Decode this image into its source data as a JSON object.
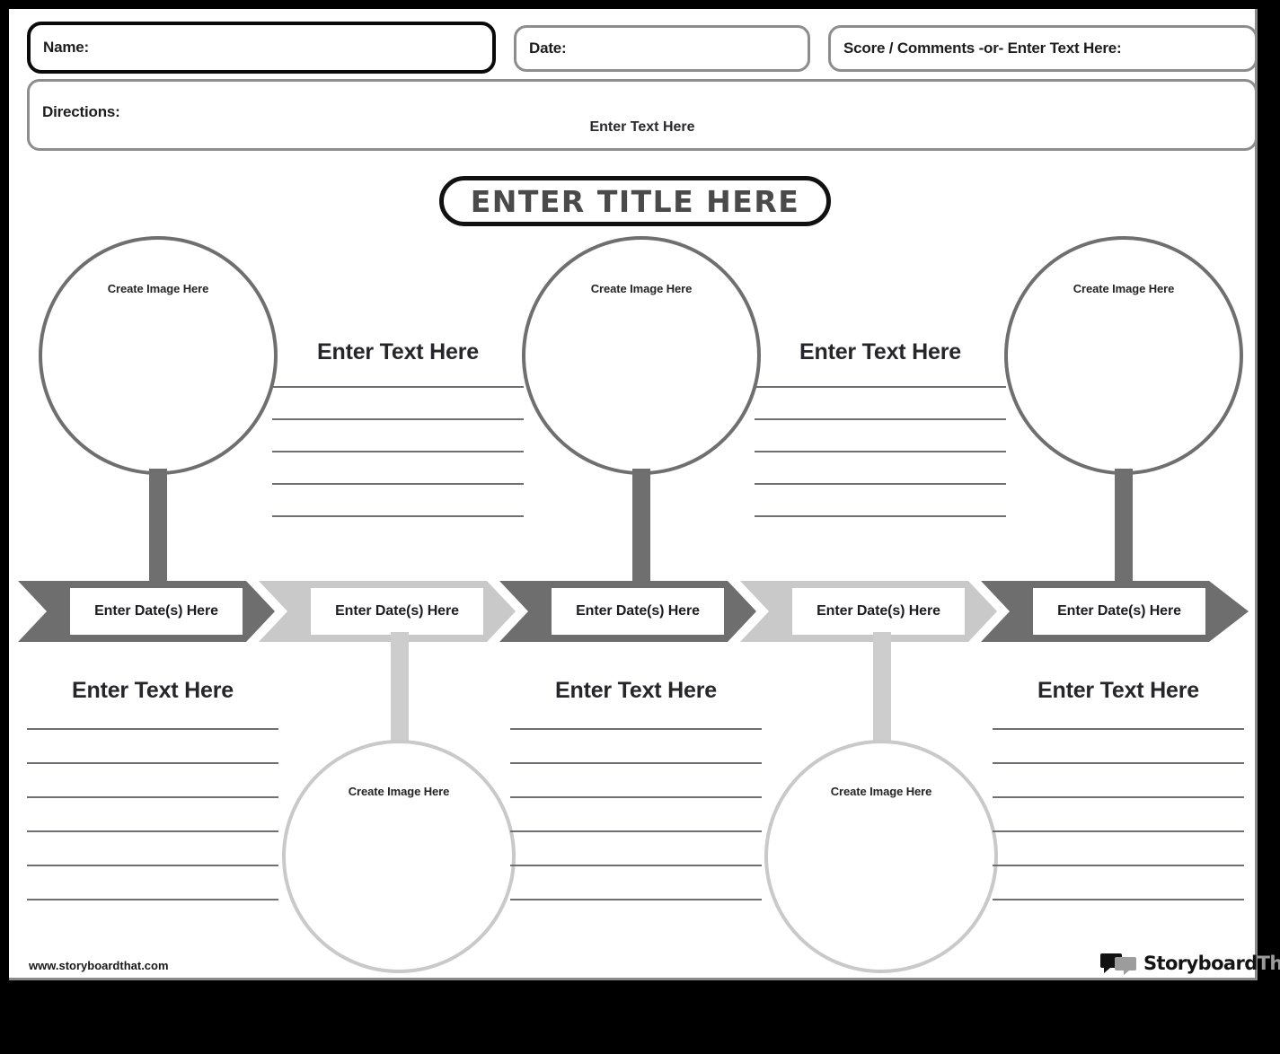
{
  "header": {
    "name_label": "Name:",
    "date_label": "Date:",
    "score_label": "Score / Comments -or- Enter Text Here:",
    "directions_label": "Directions:",
    "directions_placeholder": "Enter Text Here"
  },
  "title": {
    "text": "ENTER TITLE HERE"
  },
  "labels": {
    "create_image": "Create Image Here",
    "enter_text": "Enter Text Here",
    "enter_dates": "Enter Date(s) Here"
  },
  "timeline": {
    "steps": [
      {
        "date_label": "Enter Date(s) Here",
        "tone": "dark",
        "side": "top"
      },
      {
        "date_label": "Enter Date(s) Here",
        "tone": "light",
        "side": "bottom"
      },
      {
        "date_label": "Enter Date(s) Here",
        "tone": "dark",
        "side": "top"
      },
      {
        "date_label": "Enter Date(s) Here",
        "tone": "light",
        "side": "bottom"
      },
      {
        "date_label": "Enter Date(s) Here",
        "tone": "dark",
        "side": "top"
      }
    ]
  },
  "top_nodes": [
    {
      "image_caption": "Create Image Here"
    },
    {
      "image_caption": "Create Image Here"
    },
    {
      "image_caption": "Create Image Here"
    }
  ],
  "bottom_nodes": [
    {
      "image_caption": "Create Image Here"
    },
    {
      "image_caption": "Create Image Here"
    }
  ],
  "top_text_blocks": [
    {
      "title": "Enter Text Here",
      "lines": 5
    },
    {
      "title": "Enter Text Here",
      "lines": 5
    }
  ],
  "bottom_text_blocks": [
    {
      "title": "Enter Text Here",
      "lines": 6
    },
    {
      "title": "Enter Text Here",
      "lines": 6
    },
    {
      "title": "Enter Text Here",
      "lines": 6
    }
  ],
  "footer": {
    "url": "www.storyboardthat.com",
    "brand_primary": "Storyboard",
    "brand_secondary": "That"
  },
  "colors": {
    "dark_gray": "#6e6e6e",
    "light_gray": "#c9c9c9",
    "rule_gray": "#6e6e73",
    "ink": "#1c1c20",
    "title_ink": "#4a4a4a",
    "page": "#ffffff",
    "frame": "#000000"
  }
}
